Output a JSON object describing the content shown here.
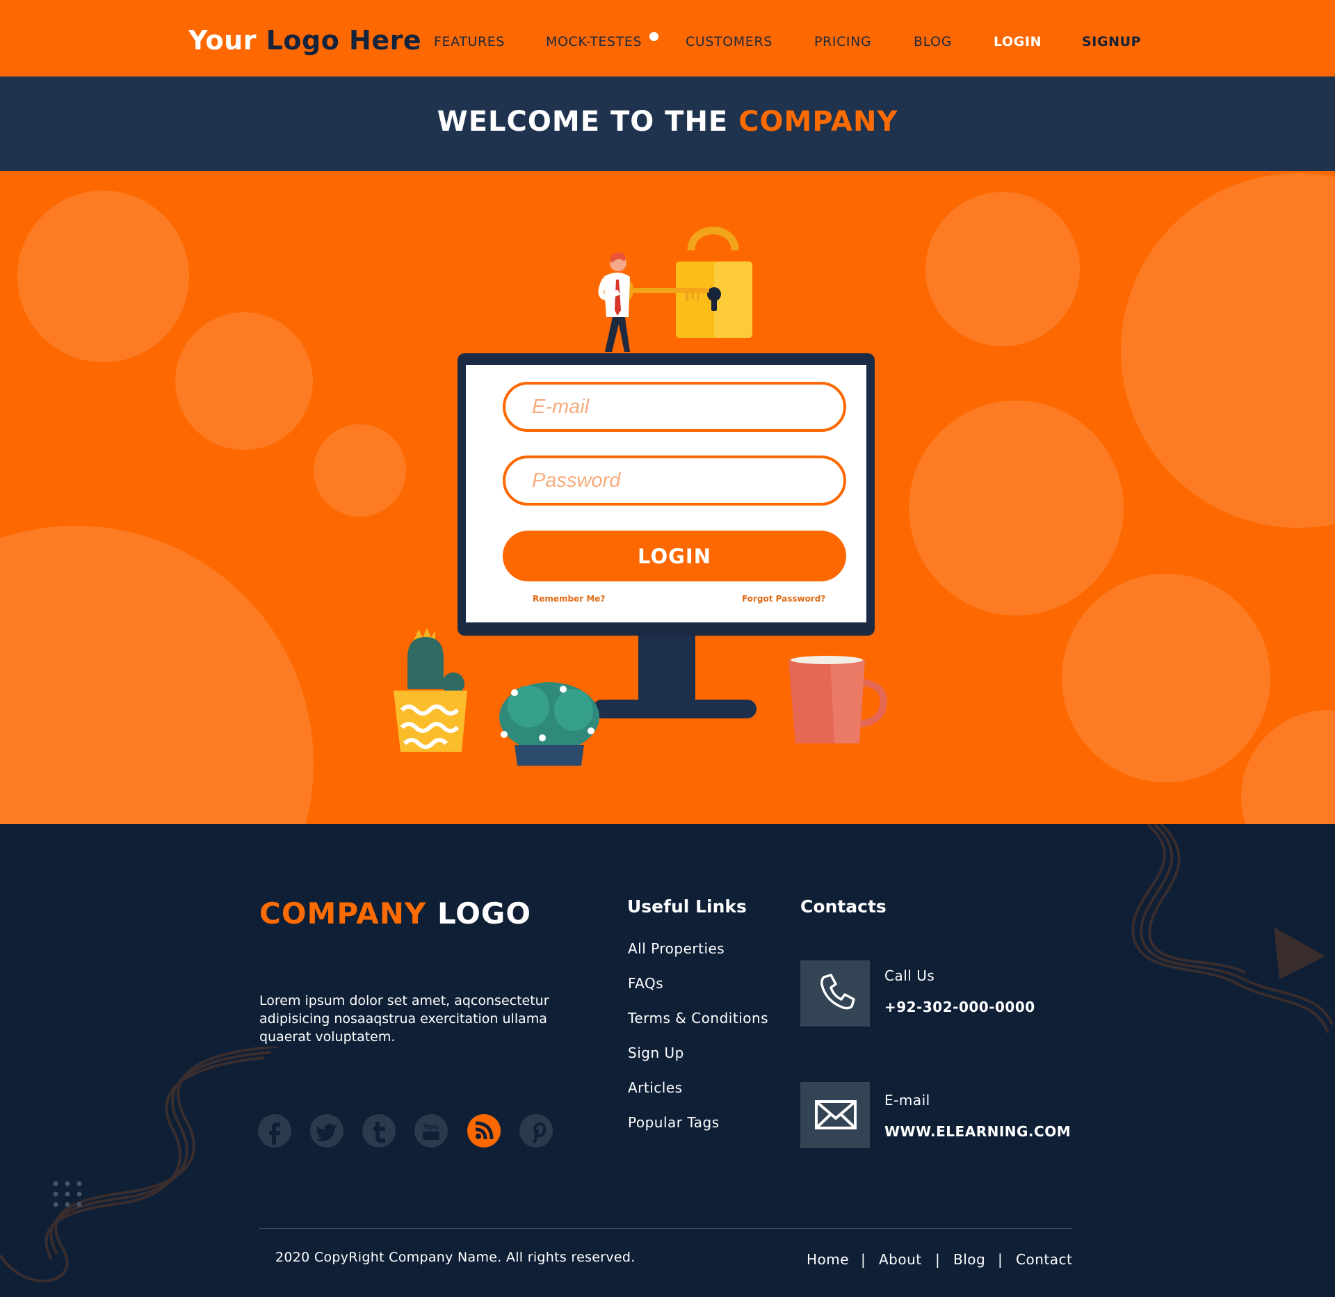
{
  "header": {
    "logo_part1": "Your",
    "logo_part2": "Logo Here",
    "nav": {
      "features": "FEATURES",
      "mock_testes": "MOCK-TESTES",
      "customers": "CUSTOMERS",
      "pricing": "PRICING",
      "blog": "BLOG",
      "login": "LOGIN",
      "signup": "SIGNUP"
    }
  },
  "banner": {
    "title_part1": "WELCOME TO THE",
    "title_part2": "COMPANY"
  },
  "login_form": {
    "email_placeholder": "E-mail",
    "password_placeholder": "Password",
    "login_label": "LOGIN",
    "remember_me": "Remember Me?",
    "forgot_password": "Forgot Password?"
  },
  "footer": {
    "logo_part1": "COMPANY",
    "logo_part2": "LOGO",
    "about": "Lorem ipsum dolor set amet, aqconsectetur adipisicing  nosaaqstrua exercitation ullama quaerat voluptatem.",
    "useful_links_title": "Useful Links",
    "useful_links": [
      "All Properties",
      "FAQs",
      "Terms & Conditions",
      "Sign Up",
      "Articles",
      "Popular Tags"
    ],
    "contacts_title": "Contacts",
    "call_label": "Call Us",
    "call_value": "+92-302-000-0000",
    "email_label": "E-mail",
    "email_value": "WWW.ELEARNING.COM",
    "social_icons": [
      "facebook-icon",
      "twitter-icon",
      "tumblr-icon",
      "youtube-icon",
      "rss-icon",
      "pinterest-icon"
    ],
    "copyright": "2020 CopyRight Company Name. All rights reserved.",
    "bottom_nav": [
      "Home",
      "About",
      "Blog",
      "Contact"
    ],
    "separator": "|"
  },
  "colors": {
    "brand_orange": "#fd6801",
    "navy": "#1f334f",
    "footer_bg": "#0f1f36"
  }
}
